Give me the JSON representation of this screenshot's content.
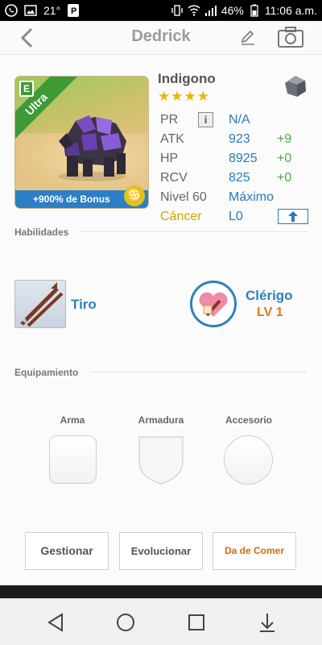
{
  "status_bar": {
    "temperature": "21°",
    "battery": "46%",
    "time": "11:06 a.m."
  },
  "header": {
    "title": "Dedrick",
    "back_icon": "chevron-left-icon",
    "edit_icon": "pencil-icon",
    "camera_icon": "camera-icon"
  },
  "card": {
    "rarity": "Ultra",
    "badge": "E",
    "bonus": "+900% de Bonus",
    "zodiac_icon": "cancer-icon"
  },
  "monster": {
    "name": "Indigono",
    "stars": "★★★★",
    "element_icon": "stone-icon"
  },
  "stats": {
    "pr": {
      "label": "PR",
      "info": "i",
      "value": "N/A"
    },
    "atk": {
      "label": "ATK",
      "value": "923",
      "bonus": "+9"
    },
    "hp": {
      "label": "HP",
      "value": "8925",
      "bonus": "+0"
    },
    "rcv": {
      "label": "RCV",
      "value": "825",
      "bonus": "+0"
    },
    "level": {
      "label": "Nivel 60",
      "value": "Máximo"
    },
    "sign": {
      "label": "Cáncer",
      "value": "L0"
    }
  },
  "abilities": {
    "section": "Habilidades",
    "skill": "Tiro",
    "class_name": "Clérigo",
    "class_level": "LV 1"
  },
  "equipment": {
    "section": "Equipamiento",
    "weapon": "Arma",
    "armor": "Armadura",
    "accessory": "Accesorio"
  },
  "actions": {
    "manage": "Gestionar",
    "evolve": "Evolucionar",
    "feed": "Da de Comer"
  },
  "colors": {
    "accent_blue": "#2d82b8",
    "bonus_green": "#4caa3f",
    "feed_orange": "#d06a10",
    "star_gold": "#f0b400"
  }
}
